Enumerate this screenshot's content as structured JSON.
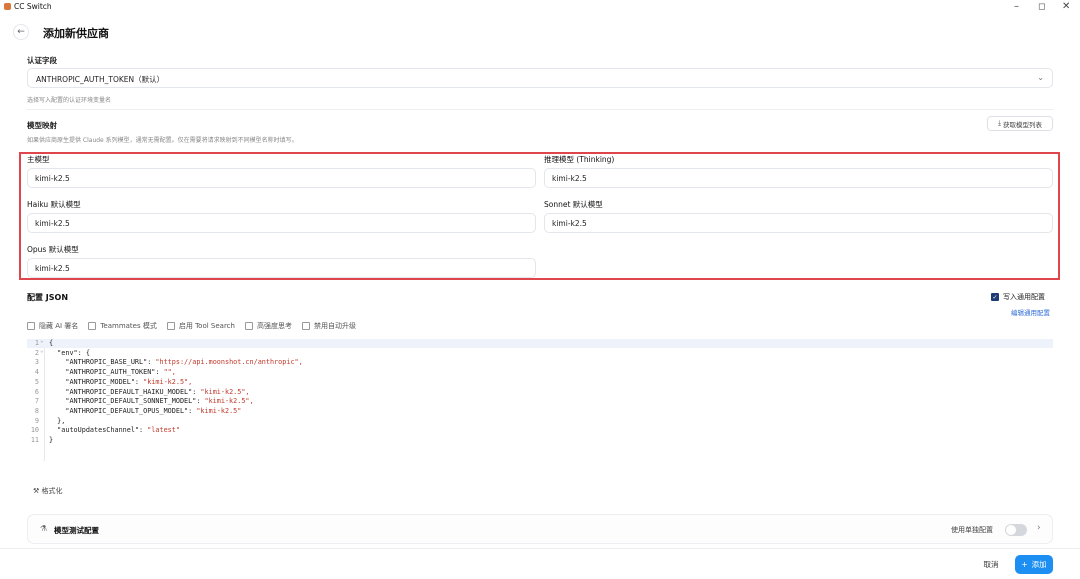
{
  "window": {
    "title": "CC Switch",
    "minimize": "–",
    "maximize": "◻",
    "close": "✕"
  },
  "header": {
    "back_icon": "arrow-left-icon",
    "title": "添加新供应商"
  },
  "auth": {
    "label": "认证字段",
    "selected": "ANTHROPIC_AUTH_TOKEN（默认）",
    "hint": "选择写入配置的认证环境变量名"
  },
  "model_mapping": {
    "label": "模型映射",
    "hint": "如果供应商原生提供 Claude 系列模型，通常无需配置。仅在需要将请求映射到不同模型名称时填写。",
    "fetch_button": "获取模型列表",
    "fields": {
      "main": {
        "label": "主模型",
        "value": "kimi-k2.5"
      },
      "thinking": {
        "label": "推理模型 (Thinking)",
        "value": "kimi-k2.5"
      },
      "haiku": {
        "label": "Haiku 默认模型",
        "value": "kimi-k2.5"
      },
      "sonnet": {
        "label": "Sonnet 默认模型",
        "value": "kimi-k2.5"
      },
      "opus": {
        "label": "Opus 默认模型",
        "value": "kimi-k2.5"
      }
    },
    "highlight_color": "#e0454b"
  },
  "json_config": {
    "label": "配置 JSON",
    "write_common": "写入通用配置",
    "write_common_checked": true,
    "edit_common": "编辑通用配置",
    "options": [
      {
        "label": "隐藏 AI 署名",
        "checked": false
      },
      {
        "label": "Teammates 模式",
        "checked": false
      },
      {
        "label": "启用 Tool Search",
        "checked": false
      },
      {
        "label": "高强度思考",
        "checked": false
      },
      {
        "label": "禁用自动升级",
        "checked": false
      }
    ],
    "lines": [
      {
        "n": "1",
        "fold": "⌄",
        "text": "{"
      },
      {
        "n": "2",
        "fold": "⌄",
        "text": "  \"env\": {"
      },
      {
        "n": "3",
        "fold": "",
        "text": "    \"ANTHROPIC_BASE_URL\": \"https://api.moonshot.cn/anthropic\","
      },
      {
        "n": "4",
        "fold": "",
        "text": "    \"ANTHROPIC_AUTH_TOKEN\": \"\","
      },
      {
        "n": "5",
        "fold": "",
        "text": "    \"ANTHROPIC_MODEL\": \"kimi-k2.5\","
      },
      {
        "n": "6",
        "fold": "",
        "text": "    \"ANTHROPIC_DEFAULT_HAIKU_MODEL\": \"kimi-k2.5\","
      },
      {
        "n": "7",
        "fold": "",
        "text": "    \"ANTHROPIC_DEFAULT_SONNET_MODEL\": \"kimi-k2.5\","
      },
      {
        "n": "8",
        "fold": "",
        "text": "    \"ANTHROPIC_DEFAULT_OPUS_MODEL\": \"kimi-k2.5\""
      },
      {
        "n": "9",
        "fold": "",
        "text": "  },"
      },
      {
        "n": "10",
        "fold": "",
        "text": "  \"autoUpdatesChannel\": \"latest\""
      },
      {
        "n": "11",
        "fold": "",
        "text": "}"
      }
    ],
    "format_button": "格式化"
  },
  "model_test": {
    "label": "模型测试配置",
    "toggle_label": "使用单独配置",
    "toggle_on": false
  },
  "footer": {
    "cancel": "取消",
    "add": "添加"
  },
  "colors": {
    "accent": "#1d8ff2",
    "link": "#2f6bd8",
    "string": "#c0392b"
  }
}
